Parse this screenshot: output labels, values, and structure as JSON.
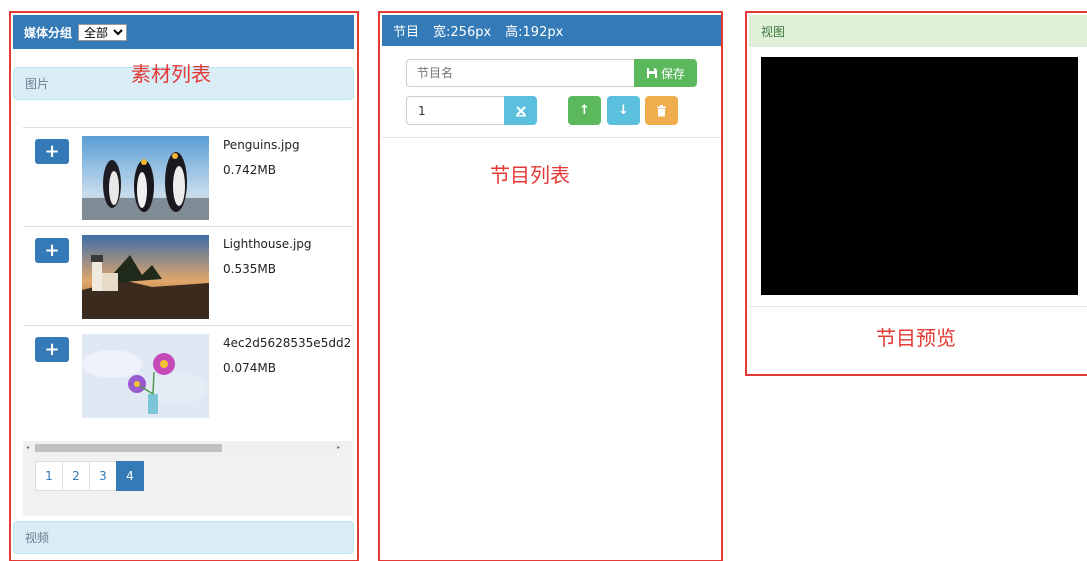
{
  "media_panel": {
    "group_label": "媒体分组",
    "group_select_value": "全部",
    "section_images": "图片",
    "section_video": "视频",
    "annotation": "素材列表",
    "items": [
      {
        "name": "Penguins.jpg",
        "size": "0.742MB",
        "thumb": "penguins"
      },
      {
        "name": "Lighthouse.jpg",
        "size": "0.535MB",
        "thumb": "lighthouse"
      },
      {
        "name": "4ec2d5628535e5dd2",
        "size": "0.074MB",
        "thumb": "flowers"
      }
    ],
    "add_icon": "plus-icon",
    "pages": [
      "1",
      "2",
      "3",
      "4"
    ],
    "current_page": "4"
  },
  "program_panel": {
    "title": "节目",
    "width_label": "宽:256px",
    "height_label": "高:192px",
    "name_placeholder": "节目名",
    "save_label": "保存",
    "save_icon": "save-icon",
    "number_value": "1",
    "annotation": "节目列表",
    "buttons": [
      {
        "icon": "clear-icon",
        "color": "#5bc0de"
      },
      {
        "icon": "arrow-up-icon",
        "color": "#5cb85c"
      },
      {
        "icon": "arrow-down-icon",
        "color": "#5bc0de"
      },
      {
        "icon": "trash-icon",
        "color": "#f0ad4e"
      }
    ]
  },
  "preview_panel": {
    "title": "视图",
    "annotation": "节目预览"
  },
  "colors": {
    "primary": "#337ab7",
    "success": "#5cb85c",
    "info": "#5bc0de",
    "warning": "#f0ad4e",
    "annotation_red": "#e53935"
  }
}
